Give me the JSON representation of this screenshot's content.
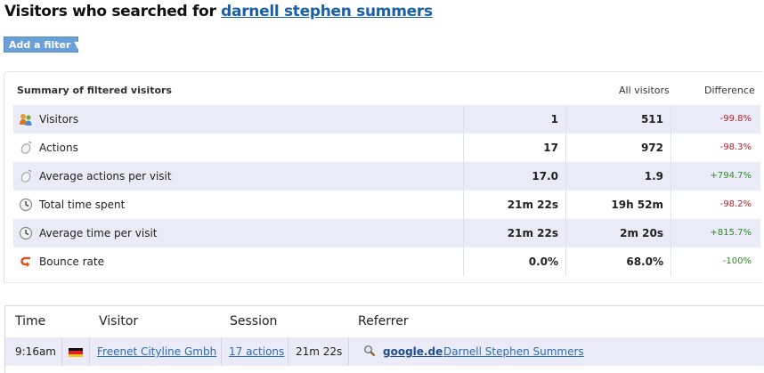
{
  "header": {
    "title_prefix": "Visitors who searched for",
    "search_term": "darnell stephen summers"
  },
  "filter": {
    "button_label": "Add a filter ▼"
  },
  "summary": {
    "heading": "Summary of filtered visitors",
    "col_all": "All visitors",
    "col_diff": "Difference",
    "rows": [
      {
        "label": "Visitors",
        "filtered": "1",
        "all": "511",
        "diff": "-99.8%",
        "icon": "visitors-icon",
        "trend": "negative"
      },
      {
        "label": "Actions",
        "filtered": "17",
        "all": "972",
        "diff": "-98.3%",
        "icon": "mouse-icon",
        "trend": "negative"
      },
      {
        "label": "Average actions per visit",
        "filtered": "17.0",
        "all": "1.9",
        "diff": "+794.7%",
        "icon": "mouse-icon",
        "trend": "positive"
      },
      {
        "label": "Total time spent",
        "filtered": "21m 22s",
        "all": "19h 52m",
        "diff": "-98.2%",
        "icon": "clock-icon",
        "trend": "negative"
      },
      {
        "label": "Average time per visit",
        "filtered": "21m 22s",
        "all": "2m 20s",
        "diff": "+815.7%",
        "icon": "clock-icon",
        "trend": "positive"
      },
      {
        "label": "Bounce rate",
        "filtered": "0.0%",
        "all": "68.0%",
        "diff": "-100%",
        "icon": "bounce-icon",
        "trend": "positive"
      }
    ],
    "colors": {
      "negative": "#b0202a",
      "positive": "#2a8a22",
      "row_shade": "#ebebf8"
    }
  },
  "log": {
    "columns": {
      "time": "Time",
      "visitor": "Visitor",
      "session": "Session",
      "referrer": "Referrer"
    },
    "rows": [
      {
        "time": "9:16am",
        "flag": "germany-flag-icon",
        "visitor": "Freenet Cityline Gmbh",
        "actions": "17 actions",
        "duration": "21m 22s",
        "engine_icon": "magnifier-icon",
        "engine": "google.de",
        "keywords": "Darnell Stephen Summers"
      }
    ]
  }
}
